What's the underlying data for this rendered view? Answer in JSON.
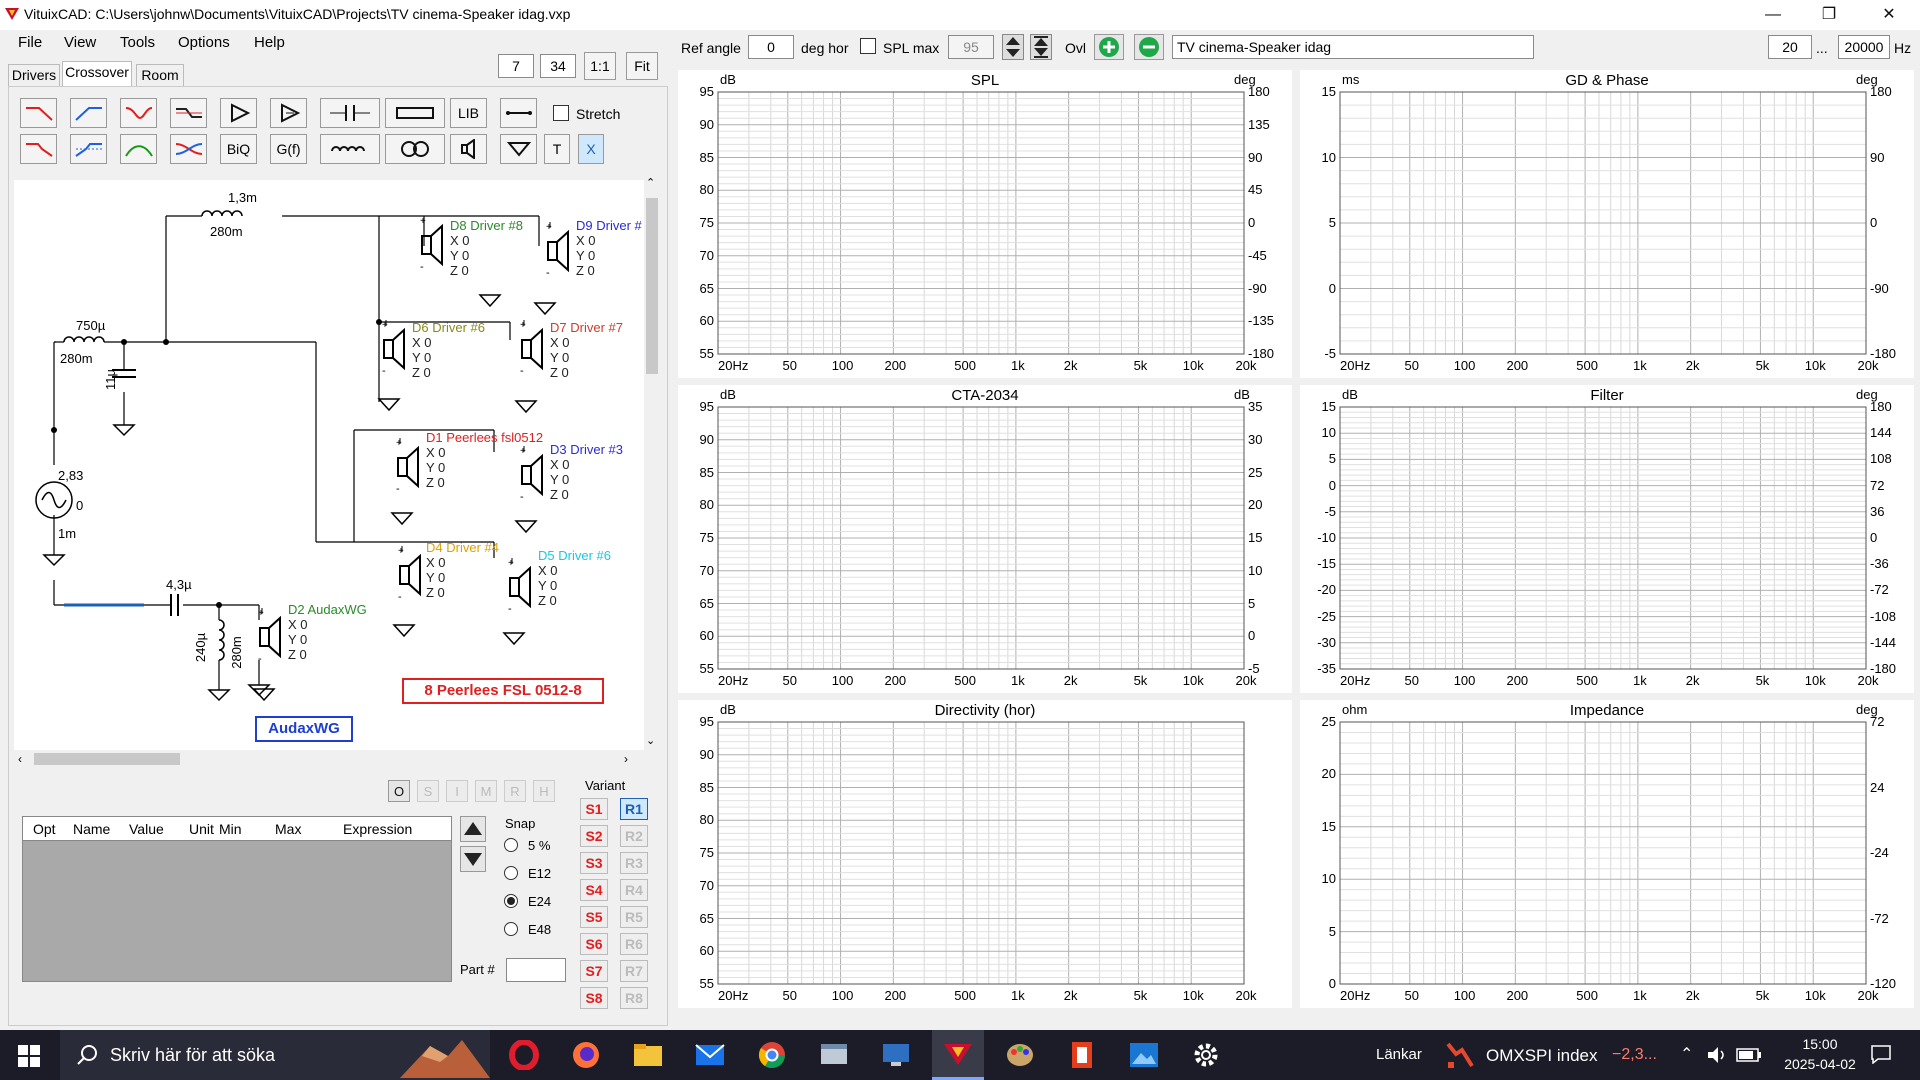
{
  "window": {
    "title": "VituixCAD: C:\\Users\\johnw\\Documents\\VituixCAD\\Projects\\TV cinema-Speaker idag.vxp",
    "minimize": "—",
    "maximize": "❐",
    "close": "✕"
  },
  "menu": [
    "File",
    "View",
    "Tools",
    "Options",
    "Help"
  ],
  "toolbar": {
    "ref_angle_label": "Ref angle",
    "ref_angle_value": "0",
    "deg_hor": "deg hor",
    "spl_max_label": "SPL max",
    "spl_max_value": "95",
    "ovl_label": "Ovl",
    "project_name": "TV cinema-Speaker idag",
    "freq_min": "20",
    "freq_sep": "...",
    "freq_max": "20000",
    "freq_unit": "Hz",
    "zoom_a": "7",
    "zoom_b": "34",
    "zoom_11": "1:1",
    "zoom_fit": "Fit"
  },
  "tabs": [
    "Drivers",
    "Crossover",
    "Room"
  ],
  "crossover_tools": {
    "row1_labels": [
      "LIB"
    ],
    "row2_labels": [
      "BiQ",
      "G(f)",
      "T",
      "X"
    ],
    "stretch_label": "Stretch"
  },
  "schematic": {
    "components": {
      "l_top": "1,3m",
      "l_top_r": "280m",
      "l_mid": "750µ",
      "l_mid_r": "280m",
      "c_mid": "11µ",
      "src_v": "2,83",
      "src_phase": "0",
      "src_r": "1m",
      "c_hp": "4,3µ",
      "l_hp": "240µ",
      "l_hp_r": "280m"
    },
    "drivers": [
      {
        "id": "d8",
        "name": "D8 Driver #8",
        "color": "#2a8a2a"
      },
      {
        "id": "d9",
        "name": "D9 Driver #",
        "color": "#2b2bd6"
      },
      {
        "id": "d6",
        "name": "D6 Driver #6",
        "color": "#8a8a1a"
      },
      {
        "id": "d7",
        "name": "D7 Driver #7",
        "color": "#d23a2a"
      },
      {
        "id": "d1",
        "name": "D1 Peerlees fsl0512",
        "color": "#e02020"
      },
      {
        "id": "d3",
        "name": "D3 Driver #3",
        "color": "#2b2bd6"
      },
      {
        "id": "d4",
        "name": "D4 Driver #4",
        "color": "#e0a000"
      },
      {
        "id": "d5",
        "name": "D5 Driver #6",
        "color": "#19c8e0"
      },
      {
        "id": "d2",
        "name": "D2 AudaxWG",
        "color": "#2a8a2a"
      }
    ],
    "xyz": [
      "X 0",
      "Y 0",
      "Z 0"
    ],
    "note_red": "8 Peerlees FSL 0512-8",
    "note_blue": "AudaxWG"
  },
  "opt_buttons": [
    "O",
    "S",
    "I",
    "M",
    "R",
    "H"
  ],
  "params_table": {
    "columns": [
      "Opt",
      "Name",
      "Value",
      "Unit",
      "Min",
      "Max",
      "Expression"
    ]
  },
  "snap": {
    "label": "Snap",
    "options": [
      "5 %",
      "E12",
      "E24",
      "E48"
    ],
    "selected": "E24",
    "part_label": "Part #"
  },
  "variant": {
    "label": "Variant",
    "s": [
      "S1",
      "S2",
      "S3",
      "S4",
      "S5",
      "S6",
      "S7",
      "S8"
    ],
    "r": [
      "R1",
      "R2",
      "R3",
      "R4",
      "R5",
      "R6",
      "R7",
      "R8"
    ]
  },
  "graphs": {
    "freq_ticks": [
      "20Hz",
      "50",
      "100",
      "200",
      "500",
      "1k",
      "2k",
      "5k",
      "10k",
      "20k"
    ],
    "spl": {
      "title": "SPL",
      "ul": "dB",
      "ur": "deg",
      "left": [
        "95",
        "90",
        "85",
        "80",
        "75",
        "70",
        "65",
        "60",
        "55"
      ],
      "right": [
        "180",
        "135",
        "90",
        "45",
        "0",
        "-45",
        "-90",
        "-135",
        "-180"
      ]
    },
    "gd": {
      "title": "GD & Phase",
      "ul": "ms",
      "ur": "deg",
      "left": [
        "15",
        "10",
        "5",
        "0",
        "-5"
      ],
      "right": [
        "180",
        "90",
        "0",
        "-90",
        "-180"
      ]
    },
    "cta": {
      "title": "CTA-2034",
      "ul": "dB",
      "ur": "dB",
      "left": [
        "95",
        "90",
        "85",
        "80",
        "75",
        "70",
        "65",
        "60",
        "55"
      ],
      "right": [
        "35",
        "30",
        "25",
        "20",
        "15",
        "10",
        "5",
        "0",
        "-5"
      ]
    },
    "filter": {
      "title": "Filter",
      "ul": "dB",
      "ur": "deg",
      "left": [
        "15",
        "10",
        "5",
        "0",
        "-5",
        "-10",
        "-15",
        "-20",
        "-25",
        "-30",
        "-35"
      ],
      "right": [
        "180",
        "144",
        "108",
        "72",
        "36",
        "0",
        "-36",
        "-72",
        "-108",
        "-144",
        "-180"
      ]
    },
    "dir": {
      "title": "Directivity (hor)",
      "ul": "dB",
      "ur": "",
      "left": [
        "95",
        "90",
        "85",
        "80",
        "75",
        "70",
        "65",
        "60",
        "55"
      ],
      "right": []
    },
    "imp": {
      "title": "Impedance",
      "ul": "ohm",
      "ur": "deg",
      "left": [
        "25",
        "20",
        "15",
        "10",
        "5",
        "0"
      ],
      "right": [
        "72",
        "24",
        "-24",
        "-72",
        "-120"
      ]
    }
  },
  "taskbar": {
    "search_placeholder": "Skriv här för att söka",
    "links": "Länkar",
    "stock_name": "OMXSPI index",
    "stock_change": "−2,3...",
    "time": "15:00",
    "date": "2025-04-02"
  }
}
